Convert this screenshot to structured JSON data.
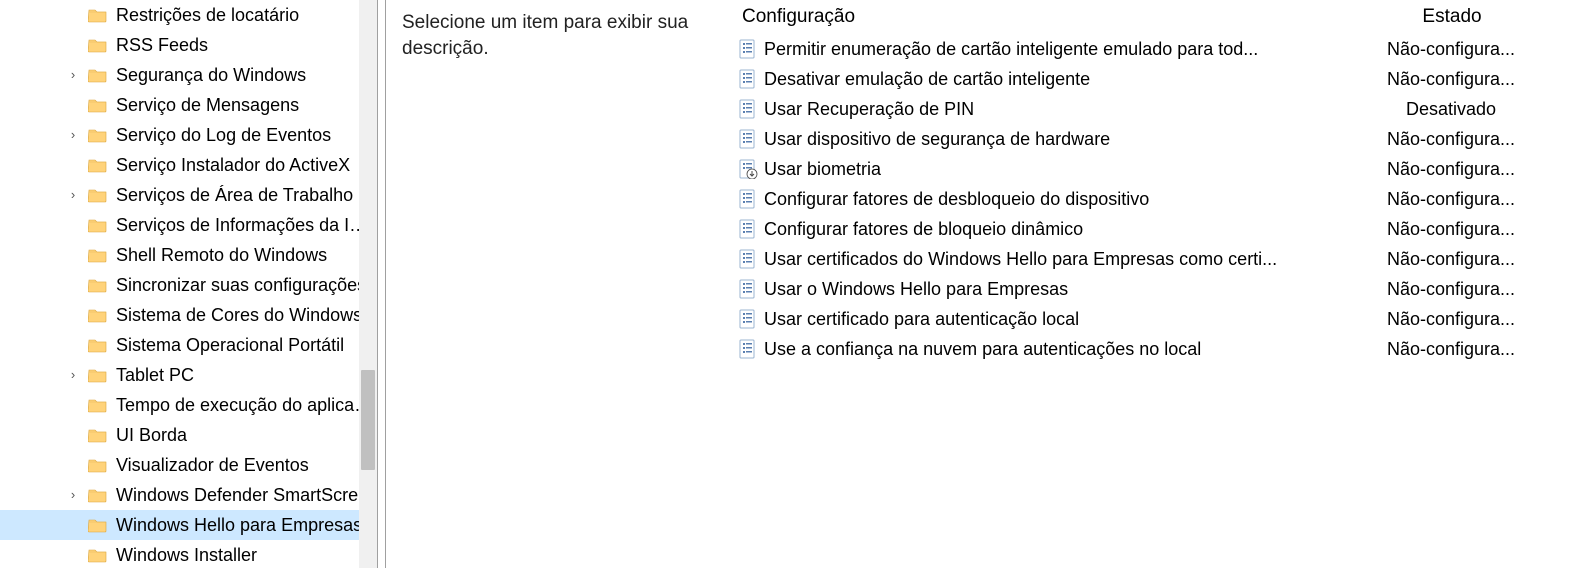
{
  "tree": {
    "items": [
      {
        "label": "Restrições de locatário",
        "expandable": false,
        "selected": false
      },
      {
        "label": "RSS Feeds",
        "expandable": false,
        "selected": false
      },
      {
        "label": "Segurança do Windows",
        "expandable": true,
        "selected": false
      },
      {
        "label": "Serviço de Mensagens",
        "expandable": false,
        "selected": false
      },
      {
        "label": "Serviço do Log de Eventos",
        "expandable": true,
        "selected": false
      },
      {
        "label": "Serviço Instalador do ActiveX",
        "expandable": false,
        "selected": false
      },
      {
        "label": "Serviços de Área de Trabalho Remota",
        "expandable": true,
        "selected": false
      },
      {
        "label": "Serviços de Informações da Internet",
        "expandable": false,
        "selected": false
      },
      {
        "label": "Shell Remoto do Windows",
        "expandable": false,
        "selected": false
      },
      {
        "label": "Sincronizar suas configurações",
        "expandable": false,
        "selected": false
      },
      {
        "label": "Sistema de Cores do Windows",
        "expandable": false,
        "selected": false
      },
      {
        "label": "Sistema Operacional Portátil",
        "expandable": false,
        "selected": false
      },
      {
        "label": "Tablet PC",
        "expandable": true,
        "selected": false
      },
      {
        "label": "Tempo de execução do aplicativo",
        "expandable": false,
        "selected": false
      },
      {
        "label": "UI Borda",
        "expandable": false,
        "selected": false
      },
      {
        "label": "Visualizador de Eventos",
        "expandable": false,
        "selected": false
      },
      {
        "label": "Windows Defender SmartScreen",
        "expandable": true,
        "selected": false
      },
      {
        "label": "Windows Hello para Empresas",
        "expandable": false,
        "selected": true
      },
      {
        "label": "Windows Installer",
        "expandable": false,
        "selected": false
      }
    ]
  },
  "description": {
    "text": "Selecione um item para exibir sua descrição."
  },
  "columns": {
    "config": "Configuração",
    "state": "Estado"
  },
  "settings": [
    {
      "name": "Permitir enumeração de cartão inteligente emulado para tod...",
      "state": "Não-configura...",
      "icon": "policy"
    },
    {
      "name": "Desativar emulação de cartão inteligente",
      "state": "Não-configura...",
      "icon": "policy"
    },
    {
      "name": "Usar Recuperação de PIN",
      "state": "Desativado",
      "icon": "policy"
    },
    {
      "name": "Usar dispositivo de segurança de hardware",
      "state": "Não-configura...",
      "icon": "policy"
    },
    {
      "name": "Usar biometria",
      "state": "Não-configura...",
      "icon": "policy-down"
    },
    {
      "name": "Configurar fatores de desbloqueio do dispositivo",
      "state": "Não-configura...",
      "icon": "policy"
    },
    {
      "name": "Configurar fatores de bloqueio dinâmico",
      "state": "Não-configura...",
      "icon": "policy"
    },
    {
      "name": "Usar certificados do Windows Hello para Empresas como certi...",
      "state": "Não-configura...",
      "icon": "policy"
    },
    {
      "name": "Usar o Windows Hello para Empresas",
      "state": "Não-configura...",
      "icon": "policy"
    },
    {
      "name": "Usar certificado para autenticação local",
      "state": "Não-configura...",
      "icon": "policy"
    },
    {
      "name": "Use a confiança na nuvem para autenticações no local",
      "state": "Não-configura...",
      "icon": "policy"
    }
  ]
}
